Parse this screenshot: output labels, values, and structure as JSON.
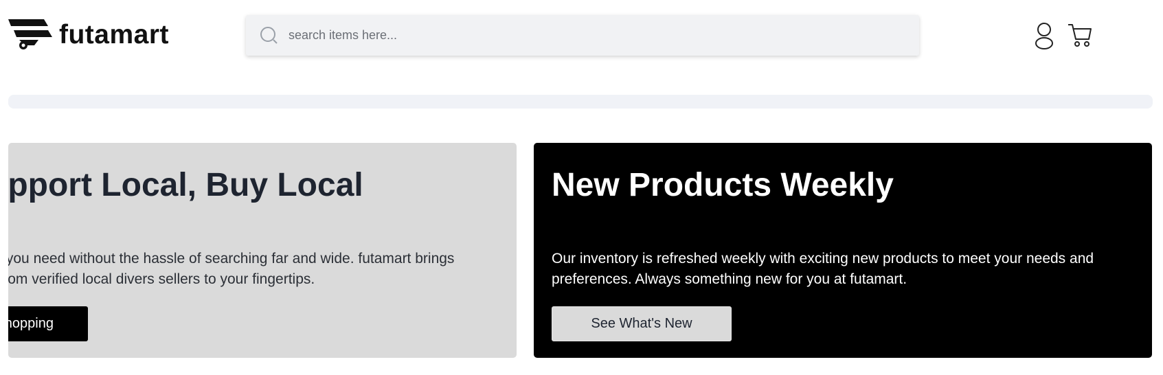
{
  "brand": {
    "name": "futamart"
  },
  "search": {
    "placeholder": "search items here..."
  },
  "header_icons": {
    "user": "user-icon",
    "cart": "cart-icon"
  },
  "promo_cards": [
    {
      "title": "Support Local, Buy Local",
      "text": "Find what you need without the hassle of searching far and wide. futamart brings products from verified local divers sellers to your fingertips.",
      "button_label": "Start Shopping",
      "background": "#dadada",
      "button_background": "#000000"
    },
    {
      "title": "New Products Weekly",
      "text": "Our inventory is refreshed weekly with exciting new products to meet your needs and preferences. Always something new for you at futamart.",
      "button_label": "See What's New",
      "background": "#000000",
      "button_background": "#dadada"
    }
  ],
  "colors": {
    "dark": "#000000",
    "light_card": "#dadada",
    "search_bg": "#f1f2f4",
    "strip_bg": "#f0f2f7"
  }
}
